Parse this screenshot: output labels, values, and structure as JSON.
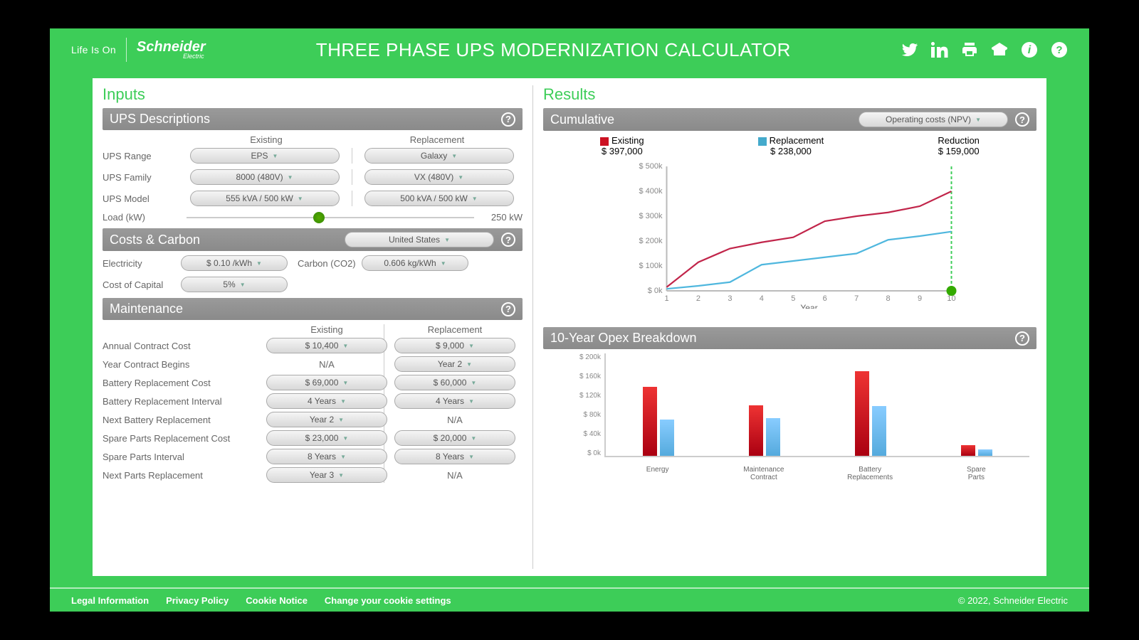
{
  "header": {
    "tagline": "Life Is On",
    "brand": "Schneider",
    "brand_sub": "Electric",
    "title": "THREE PHASE UPS MODERNIZATION CALCULATOR"
  },
  "inputs": {
    "title": "Inputs",
    "ups_section": "UPS Descriptions",
    "col_existing": "Existing",
    "col_replacement": "Replacement",
    "rows": {
      "range_label": "UPS Range",
      "range_existing": "EPS",
      "range_replacement": "Galaxy",
      "family_label": "UPS Family",
      "family_existing": "8000 (480V)",
      "family_replacement": "VX (480V)",
      "model_label": "UPS Model",
      "model_existing": "555 kVA / 500 kW",
      "model_replacement": "500 kVA / 500 kW",
      "load_label": "Load (kW)",
      "load_value": "250 kW"
    },
    "costs_section": "Costs & Carbon",
    "country": "United States",
    "electricity_label": "Electricity",
    "electricity": "$ 0.10 /kWh",
    "carbon_label": "Carbon (CO2)",
    "carbon": "0.606 kg/kWh",
    "coc_label": "Cost of Capital",
    "coc": "5%",
    "maint_section": "Maintenance",
    "maint": {
      "annual_label": "Annual Contract Cost",
      "annual_existing": "$ 10,400",
      "annual_replacement": "$ 9,000",
      "begins_label": "Year Contract Begins",
      "begins_existing": "N/A",
      "begins_replacement": "Year 2",
      "batcost_label": "Battery Replacement Cost",
      "batcost_existing": "$ 69,000",
      "batcost_replacement": "$ 60,000",
      "batint_label": "Battery Replacement Interval",
      "batint_existing": "4 Years",
      "batint_replacement": "4 Years",
      "nextbat_label": "Next Battery Replacement",
      "nextbat_existing": "Year 2",
      "nextbat_replacement": "N/A",
      "sparecost_label": "Spare Parts Replacement Cost",
      "sparecost_existing": "$ 23,000",
      "sparecost_replacement": "$ 20,000",
      "spareint_label": "Spare Parts Interval",
      "spareint_existing": "8 Years",
      "spareint_replacement": "8 Years",
      "nextparts_label": "Next Parts Replacement",
      "nextparts_existing": "Year 3",
      "nextparts_replacement": "N/A"
    }
  },
  "results": {
    "title": "Results",
    "cumulative_section": "Cumulative",
    "cumulative_dd": "Operating costs (NPV)",
    "opex_section": "10-Year Opex Breakdown",
    "legend_existing": "Existing",
    "legend_replacement": "Replacement",
    "legend_reduction": "Reduction",
    "val_existing": "$ 397,000",
    "val_replacement": "$ 238,000",
    "val_reduction": "$ 159,000",
    "xaxis_label": "Year"
  },
  "footer": {
    "legal": "Legal Information",
    "privacy": "Privacy Policy",
    "cookie": "Cookie Notice",
    "change": "Change your cookie settings",
    "copyright": "© 2022, Schneider Electric"
  },
  "chart_data": [
    {
      "type": "line",
      "title": "Cumulative Operating costs (NPV)",
      "xlabel": "Year",
      "ylabel": "$",
      "ylim": [
        0,
        500000
      ],
      "x": [
        1,
        2,
        3,
        4,
        5,
        6,
        7,
        8,
        9,
        10
      ],
      "y_ticks": [
        "$ 0k",
        "$ 100k",
        "$ 200k",
        "$ 300k",
        "$ 400k",
        "$ 500k"
      ],
      "series": [
        {
          "name": "Existing",
          "color": "#c1254a",
          "values": [
            15,
            115,
            170,
            195,
            215,
            280,
            300,
            315,
            340,
            400
          ]
        },
        {
          "name": "Replacement",
          "color": "#4fb7de",
          "values": [
            8,
            20,
            35,
            105,
            120,
            135,
            150,
            205,
            220,
            238
          ]
        }
      ]
    },
    {
      "type": "bar",
      "title": "10-Year Opex Breakdown",
      "ylabel": "$",
      "ylim": [
        0,
        200000
      ],
      "y_ticks": [
        "$ 0k",
        "$ 40k",
        "$ 80k",
        "$ 120k",
        "$ 160k",
        "$ 200k"
      ],
      "categories": [
        "Energy",
        "Maintenance Contract",
        "Battery Replacements",
        "Spare Parts"
      ],
      "series": [
        {
          "name": "Existing",
          "color": "#d4212f",
          "values": [
            133,
            97,
            163,
            21
          ]
        },
        {
          "name": "Replacement",
          "color": "#6cc2e9",
          "values": [
            70,
            73,
            96,
            13
          ]
        }
      ]
    }
  ]
}
